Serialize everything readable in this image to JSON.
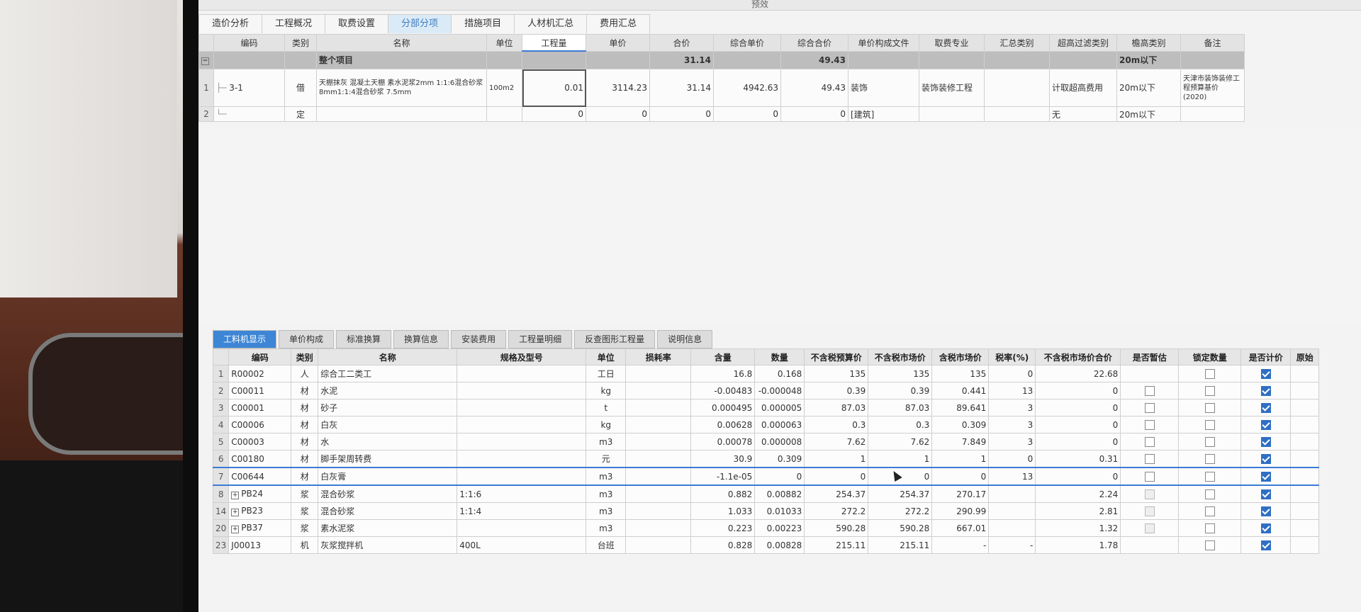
{
  "window_title": "预效",
  "main_tabs": [
    "造价分析",
    "工程概况",
    "取费设置",
    "分部分项",
    "措施项目",
    "人材机汇总",
    "费用汇总"
  ],
  "top_grid": {
    "headers": [
      "编码",
      "类别",
      "名称",
      "单位",
      "工程量",
      "单价",
      "合价",
      "综合单价",
      "综合合价",
      "单价构成文件",
      "取费专业",
      "汇总类别",
      "超高过滤类别",
      "檐高类别",
      "备注"
    ],
    "group_row": {
      "name": "整个项目",
      "hejia": "31.14",
      "zonghe_hejia": "49.43",
      "yangao": "20m以下"
    },
    "rows": [
      {
        "num": "1",
        "code": "3-1",
        "type": "借",
        "name": "天棚抹灰 混凝土天棚 素水泥浆2mm 1:1:6混合砂浆 8mm1:1:4混合砂浆 7.5mm",
        "unit": "100m2",
        "qty": "0.01",
        "price": "3114.23",
        "total": "31.14",
        "uprice": "4942.63",
        "utotal": "49.43",
        "file": "装饰",
        "major": "装饰装修工程",
        "sum_type": "",
        "filter": "计取超高费用",
        "height": "20m以下",
        "remark": "天津市装饰装修工程预算基价(2020)"
      },
      {
        "num": "2",
        "code": "",
        "type": "定",
        "name": "",
        "unit": "",
        "qty": "0",
        "price": "0",
        "total": "0",
        "uprice": "0",
        "utotal": "0",
        "file": "[建筑]",
        "major": "",
        "sum_type": "",
        "filter": "无",
        "height": "20m以下",
        "remark": ""
      }
    ]
  },
  "bottom_tabs": [
    "工料机显示",
    "单价构成",
    "标准换算",
    "换算信息",
    "安装费用",
    "工程量明细",
    "反查图形工程量",
    "说明信息"
  ],
  "bottom_grid": {
    "headers": [
      "编码",
      "类别",
      "名称",
      "规格及型号",
      "单位",
      "损耗率",
      "含量",
      "数量",
      "不含税预算价",
      "不含税市场价",
      "含税市场价",
      "税率(%)",
      "不含税市场价合价",
      "是否暂估",
      "锁定数量",
      "是否计价",
      "原始"
    ],
    "rows": [
      {
        "num": "1",
        "code": "R00002",
        "type": "人",
        "name": "综合工二类工",
        "spec": "",
        "unit": "工日",
        "loss": "",
        "content": "16.8",
        "qty": "0.168",
        "p1": "135",
        "p2": "135",
        "p3": "135",
        "tax": "0",
        "sum": "22.68",
        "est": "none",
        "lock": "off",
        "price": "on"
      },
      {
        "num": "2",
        "code": "C00011",
        "type": "材",
        "name": "水泥",
        "spec": "",
        "unit": "kg",
        "loss": "",
        "content": "-0.00483",
        "qty": "-0.000048",
        "p1": "0.39",
        "p2": "0.39",
        "p3": "0.441",
        "tax": "13",
        "sum": "0",
        "est": "off",
        "lock": "off",
        "price": "on"
      },
      {
        "num": "3",
        "code": "C00001",
        "type": "材",
        "name": "砂子",
        "spec": "",
        "unit": "t",
        "loss": "",
        "content": "0.000495",
        "qty": "0.000005",
        "p1": "87.03",
        "p2": "87.03",
        "p3": "89.641",
        "tax": "3",
        "sum": "0",
        "est": "off",
        "lock": "off",
        "price": "on"
      },
      {
        "num": "4",
        "code": "C00006",
        "type": "材",
        "name": "白灰",
        "spec": "",
        "unit": "kg",
        "loss": "",
        "content": "0.00628",
        "qty": "0.000063",
        "p1": "0.3",
        "p2": "0.3",
        "p3": "0.309",
        "tax": "3",
        "sum": "0",
        "est": "off",
        "lock": "off",
        "price": "on"
      },
      {
        "num": "5",
        "code": "C00003",
        "type": "材",
        "name": "水",
        "spec": "",
        "unit": "m3",
        "loss": "",
        "content": "0.00078",
        "qty": "0.000008",
        "p1": "7.62",
        "p2": "7.62",
        "p3": "7.849",
        "tax": "3",
        "sum": "0",
        "est": "off",
        "lock": "off",
        "price": "on"
      },
      {
        "num": "6",
        "code": "C00180",
        "type": "材",
        "name": "脚手架周转费",
        "spec": "",
        "unit": "元",
        "loss": "",
        "content": "30.9",
        "qty": "0.309",
        "p1": "1",
        "p2": "1",
        "p3": "1",
        "tax": "0",
        "sum": "0.31",
        "est": "off",
        "lock": "off",
        "price": "on"
      },
      {
        "num": "7",
        "code": "C00644",
        "type": "材",
        "name": "白灰膏",
        "spec": "",
        "unit": "m3",
        "loss": "",
        "content": "-1.1e-05",
        "qty": "0",
        "p1": "0",
        "p2": "0",
        "p3": "0",
        "tax": "13",
        "sum": "0",
        "est": "off",
        "lock": "off",
        "price": "on"
      },
      {
        "num": "8",
        "code": "PB24",
        "type": "浆",
        "name": "混合砂浆",
        "spec": "1:1:6",
        "unit": "m3",
        "loss": "",
        "content": "0.882",
        "qty": "0.00882",
        "p1": "254.37",
        "p2": "254.37",
        "p3": "270.17",
        "tax": "",
        "sum": "2.24",
        "est": "dim",
        "lock": "off",
        "price": "on"
      },
      {
        "num": "14",
        "code": "PB23",
        "type": "浆",
        "name": "混合砂浆",
        "spec": "1:1:4",
        "unit": "m3",
        "loss": "",
        "content": "1.033",
        "qty": "0.01033",
        "p1": "272.2",
        "p2": "272.2",
        "p3": "290.99",
        "tax": "",
        "sum": "2.81",
        "est": "dim",
        "lock": "off",
        "price": "on"
      },
      {
        "num": "20",
        "code": "PB37",
        "type": "浆",
        "name": "素水泥浆",
        "spec": "",
        "unit": "m3",
        "loss": "",
        "content": "0.223",
        "qty": "0.00223",
        "p1": "590.28",
        "p2": "590.28",
        "p3": "667.01",
        "tax": "",
        "sum": "1.32",
        "est": "dim",
        "lock": "off",
        "price": "on"
      },
      {
        "num": "23",
        "code": "J00013",
        "type": "机",
        "name": "灰浆搅拌机",
        "spec": "400L",
        "unit": "台班",
        "loss": "",
        "content": "0.828",
        "qty": "0.00828",
        "p1": "215.11",
        "p2": "215.11",
        "p3": "-",
        "tax": "-",
        "sum": "1.78",
        "est": "none",
        "lock": "off",
        "price": "on"
      }
    ]
  }
}
